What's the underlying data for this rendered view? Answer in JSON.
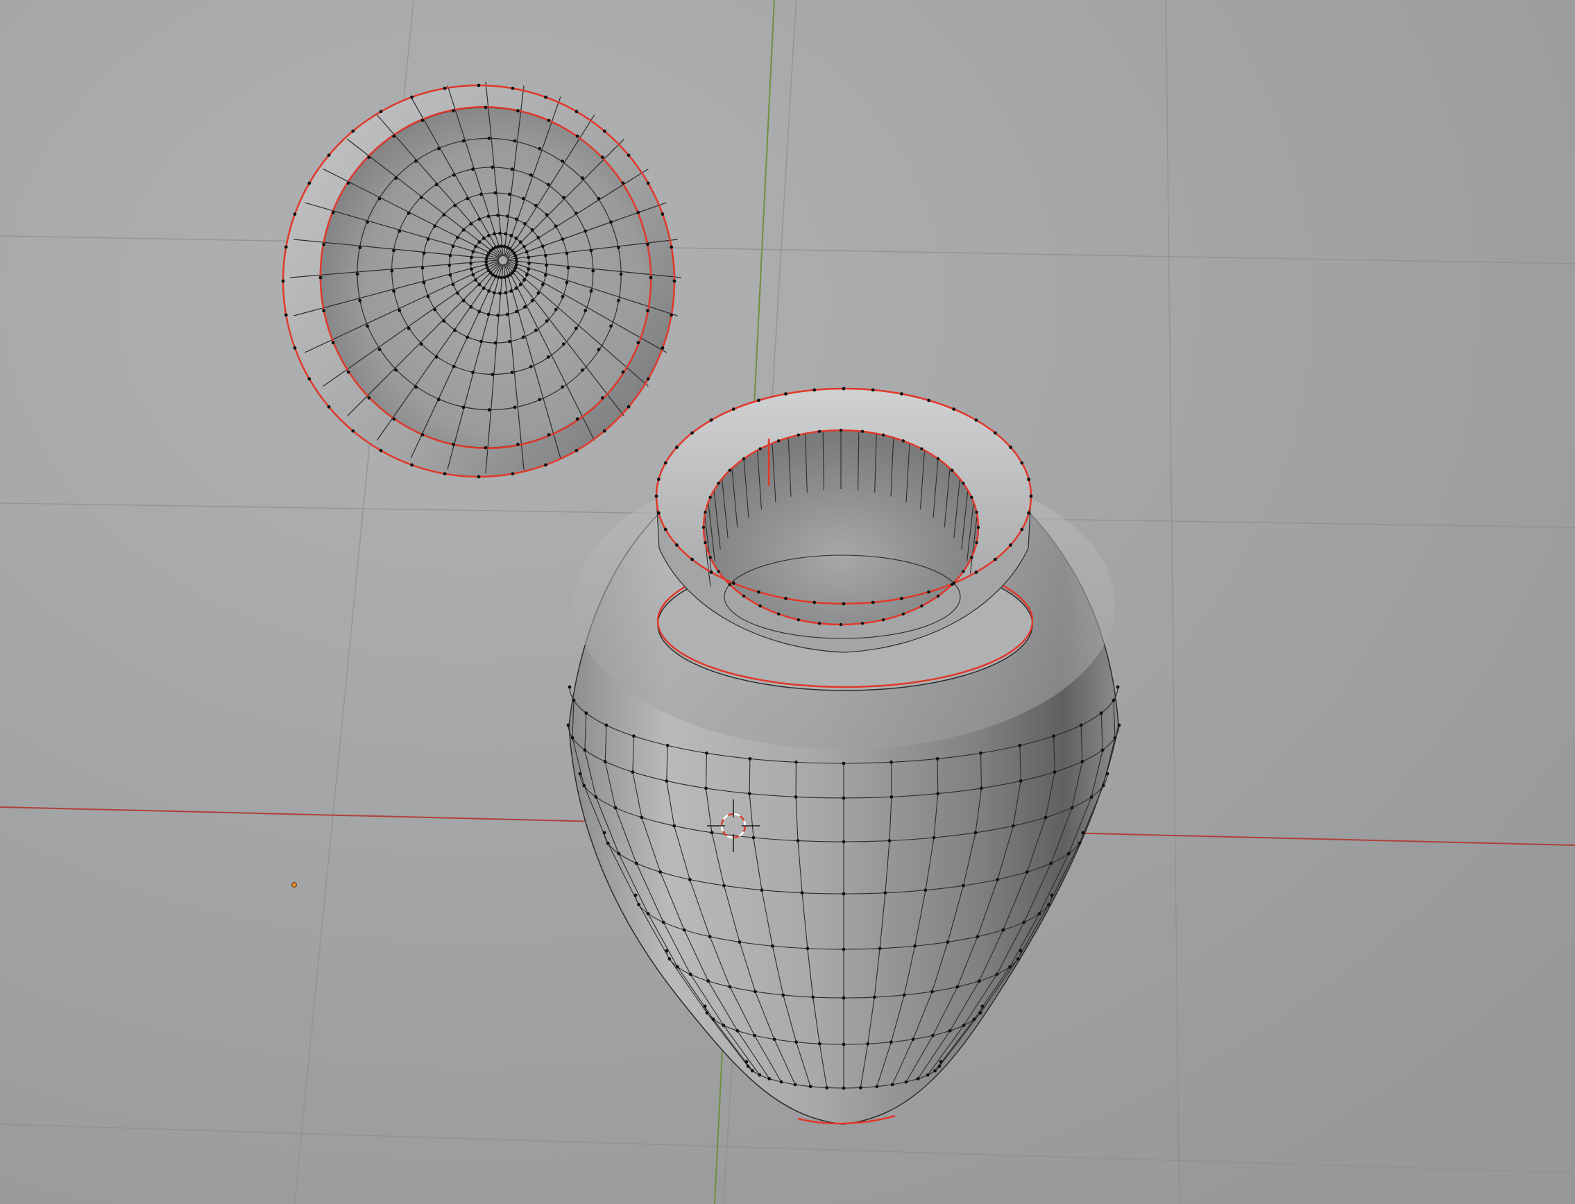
{
  "viewport": {
    "editor": "3d-viewport",
    "mode": "edit-mode",
    "shading": "solid",
    "objects": [
      "jar-lid",
      "jar-body"
    ],
    "colors": {
      "background": "#a2a4a6",
      "grid": "#8e9092",
      "x_axis": "#c0392b",
      "y_axis": "#6b8e23",
      "mesh_edge": "#2b2b2b",
      "seam_edge": "#e0382a",
      "vertex": "#111111",
      "cursor_red": "#d83a2a"
    },
    "icons": [
      "3d-cursor-icon",
      "object-origin-icon"
    ]
  }
}
